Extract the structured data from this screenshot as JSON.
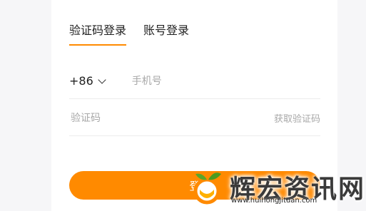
{
  "tabs": [
    {
      "label": "验证码登录",
      "active": true
    },
    {
      "label": "账号登录",
      "active": false
    }
  ],
  "phone": {
    "country_code": "+86",
    "placeholder": "手机号"
  },
  "code": {
    "placeholder": "验证码",
    "get_code_label": "获取验证码"
  },
  "login_button": {
    "label": "登"
  },
  "watermark": {
    "title": "辉宏资讯网",
    "url": "www.huihongjituan.com"
  },
  "colors": {
    "accent": "#ff8a00",
    "page_bg": "#f6f6f8"
  }
}
